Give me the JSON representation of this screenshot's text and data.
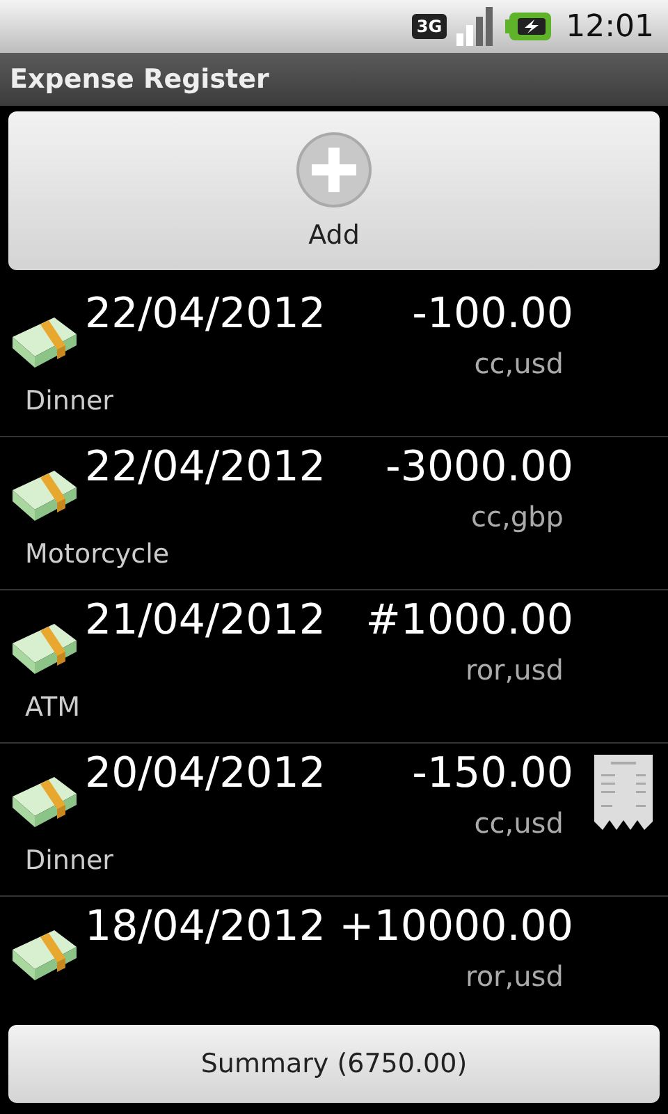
{
  "status_bar": {
    "network": "3G",
    "time": "12:01"
  },
  "title": "Expense Register",
  "add_button": {
    "label": "Add"
  },
  "expenses": [
    {
      "date": "22/04/2012",
      "amount": "-100.00",
      "tags": "cc,usd",
      "description": "Dinner",
      "receipt": false
    },
    {
      "date": "22/04/2012",
      "amount": "-3000.00",
      "tags": "cc,gbp",
      "description": "Motorcycle",
      "receipt": false
    },
    {
      "date": "21/04/2012",
      "amount": "#1000.00",
      "tags": "ror,usd",
      "description": "ATM",
      "receipt": false
    },
    {
      "date": "20/04/2012",
      "amount": "-150.00",
      "tags": "cc,usd",
      "description": "Dinner",
      "receipt": true
    },
    {
      "date": "18/04/2012",
      "amount": "+10000.00",
      "tags": "ror,usd",
      "receipt": false
    }
  ],
  "summary_button": {
    "label": "Summary (6750.00)"
  }
}
